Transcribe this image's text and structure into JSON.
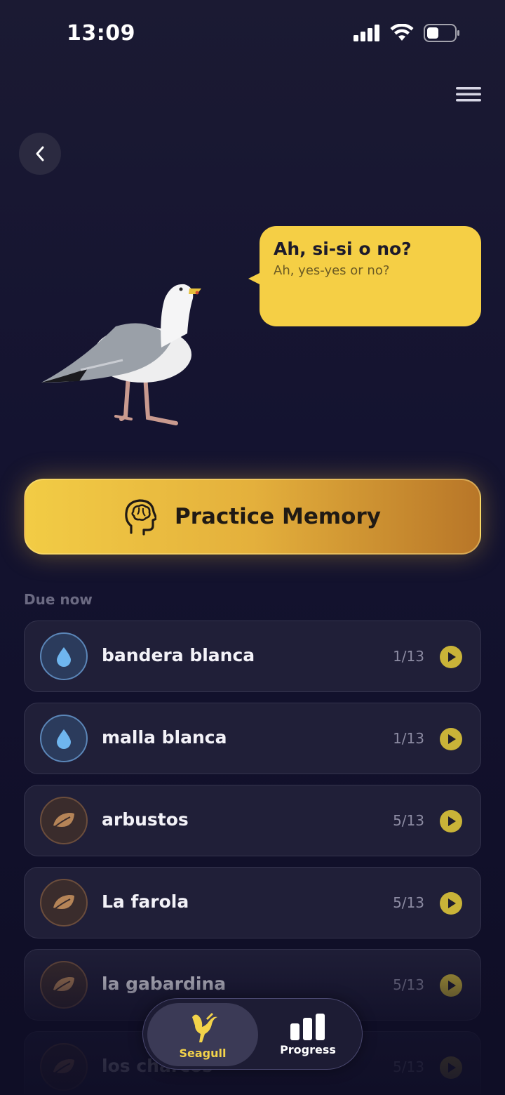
{
  "status": {
    "time": "13:09"
  },
  "speech": {
    "text": "Ah, si-si o no?",
    "translation": "Ah, yes-yes or no?"
  },
  "practice": {
    "label": "Practice Memory"
  },
  "section": {
    "title": "Due now"
  },
  "items": [
    {
      "label": "bandera blanca",
      "count": "1/13",
      "icon": "water-drop-icon"
    },
    {
      "label": "malla blanca",
      "count": "1/13",
      "icon": "water-drop-icon"
    },
    {
      "label": "arbustos",
      "count": "5/13",
      "icon": "leaf-icon"
    },
    {
      "label": "La farola",
      "count": "5/13",
      "icon": "leaf-icon"
    },
    {
      "label": "la gabardina",
      "count": "5/13",
      "icon": "leaf-icon"
    },
    {
      "label": "los charcos",
      "count": "5/13",
      "icon": "leaf-icon"
    }
  ],
  "tabs": [
    {
      "label": "Seagull",
      "active": true
    },
    {
      "label": "Progress",
      "active": false
    }
  ],
  "colors": {
    "accent": "#f5cf45",
    "background": "#141330",
    "card": "#201f38"
  }
}
